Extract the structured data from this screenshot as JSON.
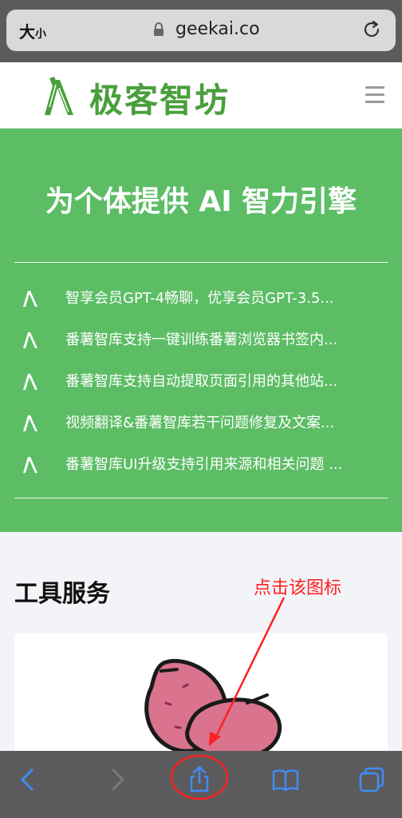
{
  "browser": {
    "text_size_label": "大",
    "text_size_label_small": "小",
    "url": "geekai.co"
  },
  "site": {
    "brand": "极客智坊"
  },
  "hero": {
    "title": "为个体提供 AI 智力引擎",
    "news": [
      {
        "text": "智享会员GPT-4畅聊，优享会员GPT-3.5..."
      },
      {
        "text": "番薯智库支持一键训练番薯浏览器书签内..."
      },
      {
        "text": "番薯智库支持自动提取页面引用的其他站..."
      },
      {
        "text": "视频翻译&番薯智库若干问题修复及文案..."
      },
      {
        "text": "番薯智库UI升级支持引用来源和相关问题 ..."
      }
    ]
  },
  "tools": {
    "title": "工具服务"
  },
  "annotation": {
    "text": "点击该图标",
    "color": "#ff2020"
  },
  "colors": {
    "brand_green": "#4a9f3d",
    "hero_green": "#5cbd65",
    "ios_blue": "#3f8cf5"
  },
  "icons": {
    "back": "chevron-left-icon",
    "forward": "chevron-right-icon",
    "share": "share-icon",
    "bookmarks": "book-icon",
    "tabs": "tabs-icon"
  }
}
